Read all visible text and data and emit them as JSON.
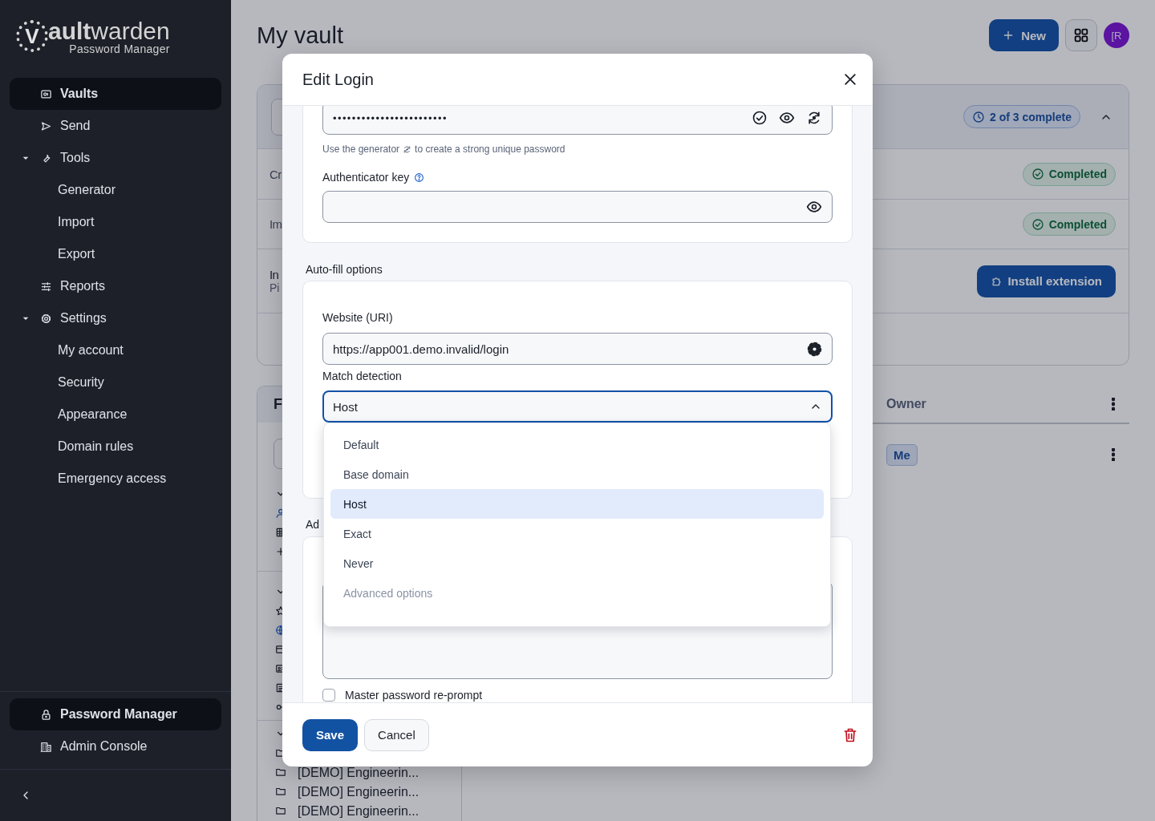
{
  "sidebar": {
    "logo": {
      "mark": "V",
      "title": "**ault**warden",
      "subtitle": "Password Manager"
    },
    "nav": [
      {
        "label": "Vaults",
        "selected": true
      },
      {
        "label": "Send",
        "selected": false
      },
      {
        "label": "Tools",
        "selected": false,
        "expanded": true,
        "children": [
          {
            "label": "Generator",
            "selected": false
          },
          {
            "label": "Import",
            "selected": false
          },
          {
            "label": "Export",
            "selected": false
          }
        ]
      },
      {
        "label": "Reports",
        "selected": false
      },
      {
        "label": "Settings",
        "selected": false,
        "expanded": true,
        "children": [
          {
            "label": "My account",
            "selected": false
          },
          {
            "label": "Security",
            "selected": false
          },
          {
            "label": "Appearance",
            "selected": false
          },
          {
            "label": "Domain rules",
            "selected": false
          },
          {
            "label": "Emergency access",
            "selected": false
          }
        ]
      }
    ],
    "products": [
      {
        "label": "Password Manager",
        "selected": true
      },
      {
        "label": "Admin Console",
        "selected": false
      }
    ]
  },
  "header": {
    "title": "My vault",
    "new_button": "New",
    "avatar": "[R"
  },
  "onboarding": {
    "progress": "2 of 3 complete",
    "expanded": true,
    "rows": [
      {
        "kind": "done",
        "title": "Cr",
        "status": "Completed"
      },
      {
        "kind": "done",
        "title": "Im",
        "status": "Completed"
      },
      {
        "kind": "action",
        "title": "In",
        "subtitle": "Pi",
        "action": "Install extension"
      }
    ]
  },
  "filters": {
    "title": "F",
    "folders": [
      {
        "label": "[DEMO] Engineerin..."
      },
      {
        "label": "[DEMO] Engineerin..."
      },
      {
        "label": "[DEMO] Engineerin..."
      }
    ]
  },
  "table": {
    "columns": [
      {
        "label": "Owner"
      }
    ],
    "rows": [
      {
        "owner": "Me"
      }
    ]
  },
  "modal": {
    "title": "Edit Login",
    "password": {
      "value": "••••••••••••••••••••••••",
      "hint_start": "Use the generator",
      "hint_end": "to create a strong unique password"
    },
    "authenticator": {
      "label": "Authenticator key"
    },
    "autofill": {
      "heading": "Auto-fill options",
      "uri_label": "Website (URI)",
      "uri": "https://app001.demo.invalid/login",
      "match_label": "Match detection",
      "match_value": "Host",
      "open": true,
      "options": [
        {
          "kind": "option",
          "label": "Default",
          "selected": false
        },
        {
          "kind": "option",
          "label": "Base domain",
          "selected": false
        },
        {
          "kind": "option",
          "label": "Host",
          "selected": true
        },
        {
          "kind": "option",
          "label": "Exact",
          "selected": false
        },
        {
          "kind": "option",
          "label": "Never",
          "selected": false
        },
        {
          "kind": "group",
          "label": "Advanced options"
        }
      ]
    },
    "additional": {
      "heading": "Ad",
      "reprompt": {
        "label": "Master password re-prompt",
        "checked": false
      }
    },
    "save": "Save",
    "cancel": "Cancel"
  }
}
